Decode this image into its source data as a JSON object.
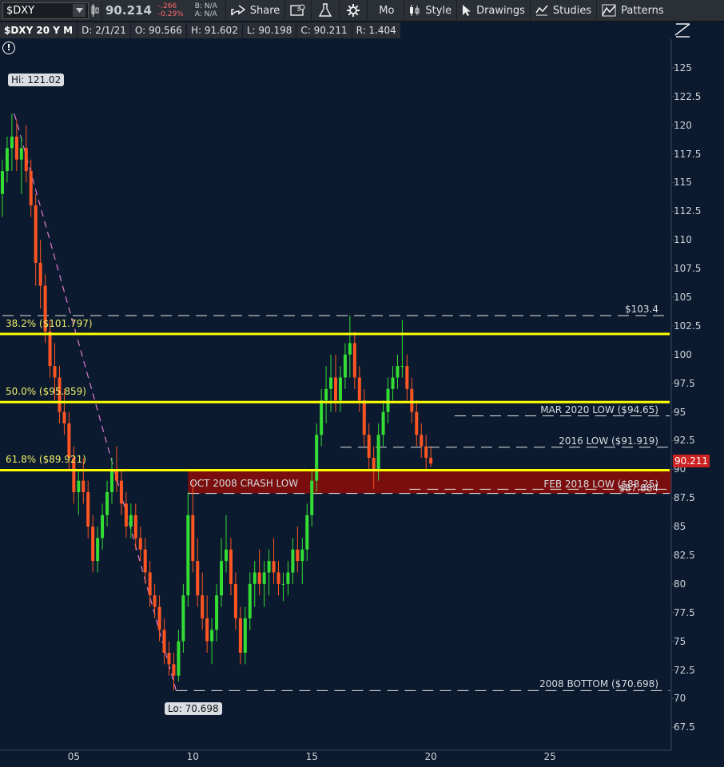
{
  "toolbar": {
    "symbol": "$DXY",
    "last": "90.214",
    "change": "-.266",
    "change_pct": "-0.29%",
    "bid": "B: N/A",
    "ask": "A: N/A",
    "share": "Share",
    "mo": "Mo",
    "style": "Style",
    "drawings": "Drawings",
    "studies": "Studies",
    "patterns": "Patterns"
  },
  "infobar": {
    "title": "$DXY 20 Y M",
    "date": "D: 2/1/21",
    "open": "O: 90.566",
    "high": "H: 91.602",
    "low": "L: 90.198",
    "close": "C: 90.211",
    "range": "R: 1.404"
  },
  "colors": {
    "background": "#0b1a2e",
    "up": "#33dd33",
    "down": "#ff5522",
    "fib": "#ffff00",
    "zone": "#7a0d0d",
    "price_tag": "#cc2222"
  },
  "chart_data": {
    "type": "candlestick",
    "ylim": [
      65.5,
      127.5
    ],
    "xlim": [
      0.9,
      29.1
    ],
    "x_ticks": [
      "05",
      "10",
      "15",
      "20",
      "25"
    ],
    "y_ticks": [
      "125",
      "122.5",
      "120",
      "117.5",
      "115",
      "112.5",
      "110",
      "107.5",
      "105",
      "102.5",
      "100",
      "97.5",
      "95",
      "92.5",
      "90",
      "87.5",
      "85",
      "82.5",
      "80",
      "77.5",
      "75",
      "72.5",
      "70",
      "67.5"
    ],
    "fib_levels": [
      {
        "label": "38.2% ($101.797)",
        "value": 101.797
      },
      {
        "label": "50.0% ($95.859)",
        "value": 95.859
      },
      {
        "label": "61.8% ($89.921)",
        "value": 89.921
      }
    ],
    "levels": [
      {
        "label": "$103.4",
        "value": 103.4,
        "x_from": 1
      },
      {
        "label": "MAR 2020 LOW ($94.65)",
        "value": 94.65,
        "x_from": 20.0
      },
      {
        "label": "2016 LOW ($91.919)",
        "value": 91.919,
        "x_from": 15.2
      },
      {
        "label": "FEB 2018 LOW ($88.25)",
        "value": 88.25,
        "x_from": 18.1
      },
      {
        "label": "$87.884",
        "value": 87.884,
        "x_from": 8.8
      },
      {
        "label": "2008 BOTTOM ($70.698)",
        "value": 70.698,
        "x_from": 8.3
      }
    ],
    "zone": {
      "label": "OCT 2008 CRASH LOW",
      "from": 87.884,
      "to": 89.921,
      "x_from": 8.8
    },
    "high_label": "Hi: 121.02",
    "low_label": "Lo: 70.698",
    "swing": {
      "high": {
        "x": 1.5,
        "y": 121.02
      },
      "low": {
        "x": 8.3,
        "y": 70.698
      }
    },
    "last_price": "90.211",
    "candles": [
      [
        1.0,
        114,
        117,
        112,
        116
      ],
      [
        1.2,
        116,
        119,
        115,
        118
      ],
      [
        1.4,
        118,
        121,
        116,
        119
      ],
      [
        1.6,
        119,
        120.5,
        116,
        117
      ],
      [
        1.8,
        117,
        119,
        114,
        118
      ],
      [
        2.0,
        118,
        120,
        115,
        116
      ],
      [
        2.2,
        116,
        117,
        112,
        113
      ],
      [
        2.4,
        113,
        114,
        106,
        108
      ],
      [
        2.6,
        108,
        110,
        104,
        106
      ],
      [
        2.8,
        106,
        107,
        101,
        102
      ],
      [
        3.0,
        102,
        103,
        98,
        99
      ],
      [
        3.2,
        99,
        101,
        96,
        98
      ],
      [
        3.4,
        98,
        99,
        94,
        95
      ],
      [
        3.6,
        95,
        97,
        93,
        94
      ],
      [
        3.8,
        94,
        95,
        90,
        91
      ],
      [
        4.0,
        91,
        92,
        87,
        88
      ],
      [
        4.2,
        88,
        90,
        86,
        89
      ],
      [
        4.4,
        89,
        91,
        87,
        88
      ],
      [
        4.6,
        88,
        89,
        84,
        85
      ],
      [
        4.8,
        85,
        86,
        81,
        82
      ],
      [
        5.0,
        82,
        85,
        81,
        84
      ],
      [
        5.2,
        84,
        87,
        83,
        86
      ],
      [
        5.4,
        86,
        89,
        85,
        88
      ],
      [
        5.6,
        88,
        91,
        87,
        90
      ],
      [
        5.8,
        90,
        92,
        88,
        89
      ],
      [
        6.0,
        89,
        90,
        86,
        87
      ],
      [
        6.2,
        87,
        88,
        84,
        85
      ],
      [
        6.4,
        85,
        87,
        84,
        86
      ],
      [
        6.6,
        86,
        87,
        83,
        84
      ],
      [
        6.8,
        84,
        85,
        82,
        83
      ],
      [
        7.0,
        83,
        84,
        80,
        81
      ],
      [
        7.2,
        81,
        82,
        78,
        79
      ],
      [
        7.4,
        79,
        80,
        77,
        78
      ],
      [
        7.6,
        78,
        79,
        75,
        76
      ],
      [
        7.8,
        76,
        77,
        73,
        74
      ],
      [
        8.0,
        74,
        75,
        72,
        73
      ],
      [
        8.2,
        73,
        74,
        70.7,
        72
      ],
      [
        8.4,
        72,
        76,
        71.5,
        75
      ],
      [
        8.6,
        75,
        80,
        74,
        79
      ],
      [
        8.8,
        79,
        88,
        78,
        86
      ],
      [
        9.0,
        86,
        89,
        81,
        82
      ],
      [
        9.2,
        82,
        84,
        78,
        79
      ],
      [
        9.4,
        79,
        81,
        76,
        77
      ],
      [
        9.6,
        77,
        79,
        74,
        75
      ],
      [
        9.8,
        75,
        77,
        73,
        76
      ],
      [
        10.0,
        76,
        80,
        75,
        79
      ],
      [
        10.2,
        79,
        84,
        78,
        82
      ],
      [
        10.4,
        82,
        86,
        81,
        83
      ],
      [
        10.6,
        83,
        84,
        79,
        80
      ],
      [
        10.8,
        80,
        81,
        76,
        77
      ],
      [
        11.0,
        77,
        78,
        73,
        74
      ],
      [
        11.2,
        74,
        78,
        73,
        77
      ],
      [
        11.4,
        77,
        81,
        76,
        80
      ],
      [
        11.6,
        80,
        82,
        78,
        81
      ],
      [
        11.8,
        81,
        83,
        79,
        80
      ],
      [
        12.0,
        80,
        82,
        78,
        81
      ],
      [
        12.2,
        81,
        83,
        79,
        82
      ],
      [
        12.4,
        82,
        84,
        80,
        81
      ],
      [
        12.6,
        81,
        82,
        79,
        80
      ],
      [
        12.8,
        80,
        81,
        78.5,
        80
      ],
      [
        13.0,
        80,
        82,
        79,
        81
      ],
      [
        13.2,
        81,
        84,
        80,
        83
      ],
      [
        13.4,
        83,
        85,
        81,
        82
      ],
      [
        13.6,
        82,
        84,
        80,
        83
      ],
      [
        13.8,
        83,
        87,
        82,
        86
      ],
      [
        14.0,
        86,
        90,
        85,
        89
      ],
      [
        14.2,
        89,
        94,
        88,
        93
      ],
      [
        14.4,
        93,
        97,
        92,
        96
      ],
      [
        14.6,
        96,
        99,
        94,
        97
      ],
      [
        14.8,
        97,
        100,
        95,
        98
      ],
      [
        15.0,
        98,
        100,
        95,
        96
      ],
      [
        15.2,
        96,
        99,
        95,
        98
      ],
      [
        15.4,
        98,
        101,
        97,
        100
      ],
      [
        15.6,
        100,
        103.4,
        98,
        101
      ],
      [
        15.8,
        101,
        102,
        97,
        98
      ],
      [
        16.0,
        98,
        99,
        95,
        96
      ],
      [
        16.2,
        96,
        97,
        92,
        93
      ],
      [
        16.4,
        93,
        94,
        90,
        91
      ],
      [
        16.6,
        91,
        92,
        88.3,
        90
      ],
      [
        16.8,
        90,
        94,
        89,
        93
      ],
      [
        17.0,
        93,
        96,
        92,
        95
      ],
      [
        17.2,
        95,
        98,
        94,
        97
      ],
      [
        17.4,
        97,
        99,
        96,
        98
      ],
      [
        17.6,
        98,
        100,
        97,
        99
      ],
      [
        17.8,
        99,
        103,
        98,
        99
      ],
      [
        18.0,
        99,
        100,
        96,
        97
      ],
      [
        18.2,
        97,
        98,
        94,
        95
      ],
      [
        18.4,
        95,
        96,
        92,
        93
      ],
      [
        18.6,
        93,
        94,
        91,
        92
      ],
      [
        18.8,
        92,
        93,
        90,
        91
      ],
      [
        19.0,
        91,
        92,
        90.2,
        90.5
      ]
    ]
  }
}
